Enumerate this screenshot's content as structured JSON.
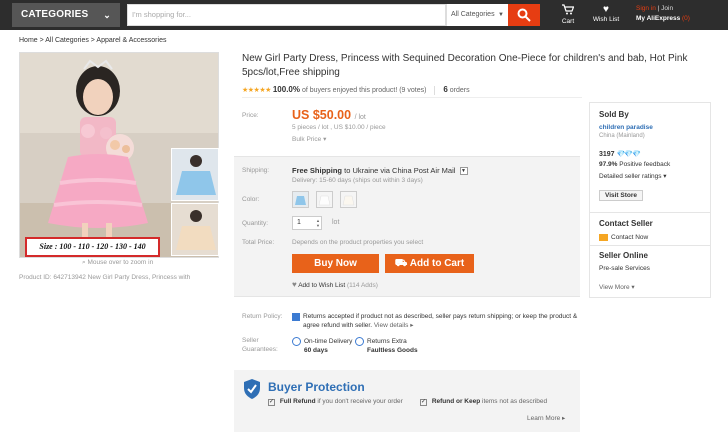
{
  "topbar": {
    "categories_label": "CATEGORIES",
    "search_placeholder": "I'm shopping for...",
    "search_category": "All Categories",
    "cart_label": "Cart",
    "wishlist_label": "Wish List",
    "signin": "Sign in",
    "join": "| Join",
    "my_aliexpress": "My AliExpress",
    "my_count": "(0)"
  },
  "breadcrumb": "Home > All Categories > Apparel & Accessories",
  "gallery": {
    "size_label": "Size : 100 - 110 - 120 - 130 - 140",
    "zoom_hint": "Mouse over to zoom in",
    "product_id": "Product ID: 642713942 New Girl Party Dress, Princess with"
  },
  "product": {
    "title": "New Girl Party Dress, Princess with Sequined Decoration One-Piece for children's and bab, Hot Pink 5pcs/lot,Free shipping",
    "stars": "★★★★★",
    "rating_pct": "100.0%",
    "rating_text": "of buyers enjoyed this product! (9 votes)",
    "orders_count": "6",
    "orders_label": "orders"
  },
  "price": {
    "label": "Price:",
    "value": "US $50.00",
    "unit": "/ lot",
    "sub": "5 pieces / lot , US $10.00 / piece",
    "bulk": "Bulk Price ▾"
  },
  "shipping": {
    "label": "Shipping:",
    "free": "Free Shipping",
    "to": "to Ukraine via China Post Air Mail",
    "delivery": "Delivery: 15-60 days (ships out within 3 days)"
  },
  "color_label": "Color:",
  "quantity": {
    "label": "Quantity:",
    "value": "1",
    "unit": "lot"
  },
  "total": {
    "label": "Total Price:",
    "text": "Depends on the product properties you select"
  },
  "buttons": {
    "buy_now": "Buy Now",
    "add_to_cart": "Add to Cart"
  },
  "wishlist": {
    "label": "Add to Wish List",
    "count": "(114 Adds)"
  },
  "return_policy": {
    "label": "Return Policy:",
    "text": "Returns accepted if product not as described, seller pays return shipping; or keep the product & agree refund with seller.",
    "link": "View details ▸"
  },
  "guarantees": {
    "label": "Seller Guarantees:",
    "ontime_title": "On-time Delivery",
    "ontime_value": "60 days",
    "returns_title": "Returns Extra",
    "returns_value": "Faultless Goods"
  },
  "protection": {
    "title": "Buyer Protection",
    "item1_bold": "Full Refund",
    "item1_rest": "if you don't receive your order",
    "item2_bold": "Refund or Keep",
    "item2_rest": "items not as described",
    "learn_more": "Learn More ▸"
  },
  "seller": {
    "sold_by": "Sold By",
    "name": "children paradise",
    "country": "China (Mainland)",
    "score": "3197",
    "diamonds": "💎💎💎",
    "feedback_pct": "97.9%",
    "feedback_label": "Positive feedback",
    "ratings_link": "Detailed seller ratings ▾",
    "visit_store": "Visit Store",
    "contact_title": "Contact Seller",
    "contact_now": "Contact Now",
    "online_title": "Seller Online",
    "presale": "Pre-sale Services",
    "view_more": "View More ▾"
  },
  "colors": {
    "accent": "#e8621a",
    "topbar": "#2d2d2d",
    "link": "#2f6fb5"
  }
}
